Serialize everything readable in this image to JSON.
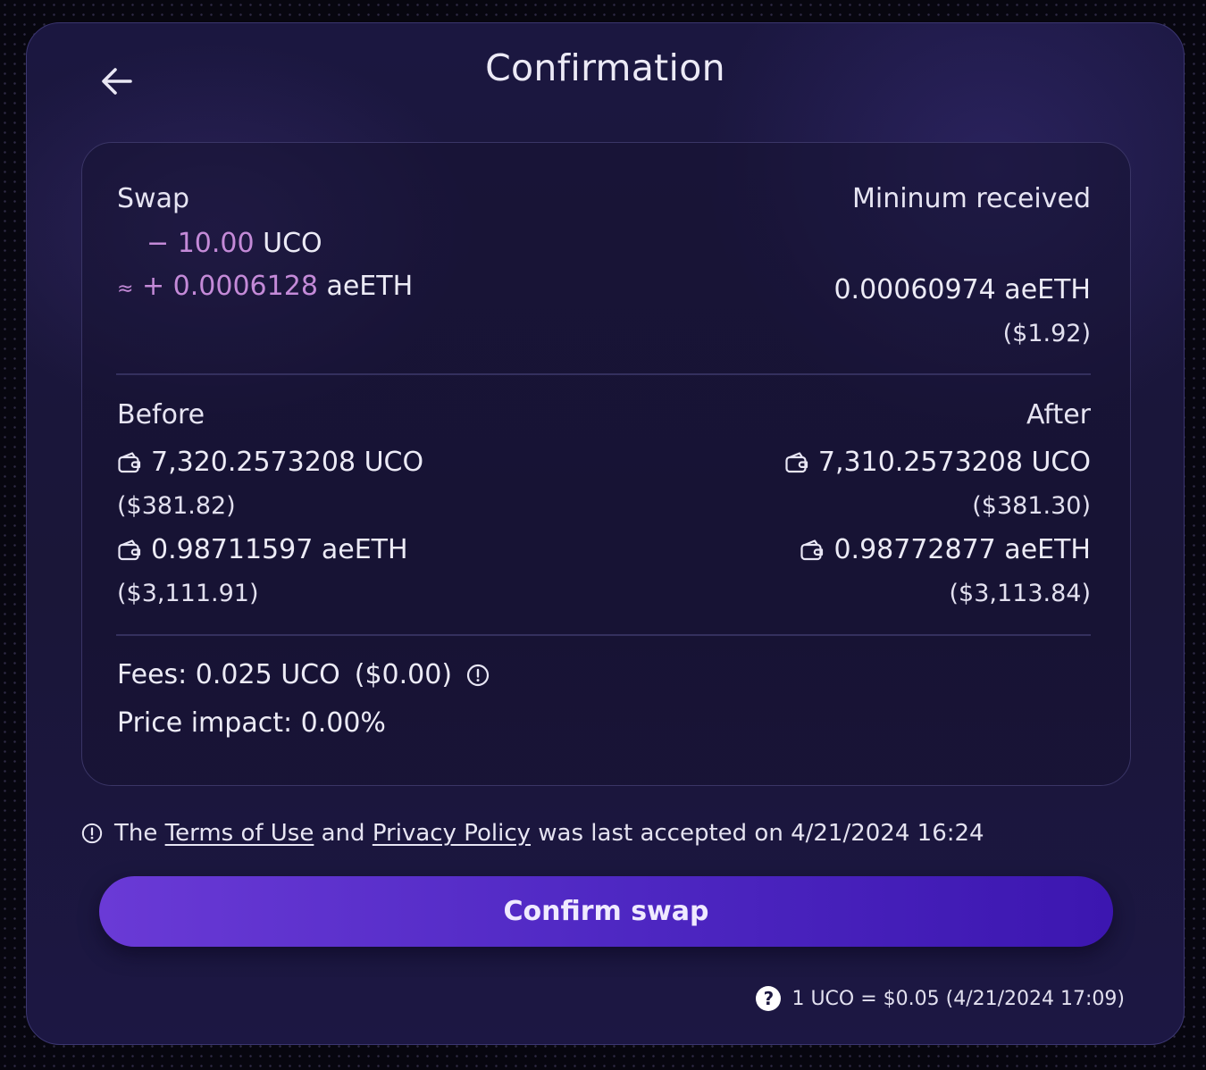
{
  "header": {
    "title": "Confirmation"
  },
  "swap": {
    "label": "Swap",
    "from_sign": "−",
    "from_amount": "10.00",
    "from_token": "UCO",
    "to_approx": "≈",
    "to_sign": "+",
    "to_amount": "0.0006128",
    "to_token": "aeETH"
  },
  "minimum_received": {
    "label": "Mininum received",
    "amount": "0.00060974 aeETH",
    "usd": "($1.92)"
  },
  "before": {
    "label": "Before",
    "uco_amount": "7,320.2573208 UCO",
    "uco_usd": "($381.82)",
    "aeeth_amount": "0.98711597 aeETH",
    "aeeth_usd": "($3,111.91)"
  },
  "after": {
    "label": "After",
    "uco_amount": "7,310.2573208 UCO",
    "uco_usd": "($381.30)",
    "aeeth_amount": "0.98772877 aeETH",
    "aeeth_usd": "($3,113.84)"
  },
  "fees": {
    "text": "Fees: 0.025 UCO",
    "usd": "($0.00)"
  },
  "price_impact": {
    "text": "Price impact: 0.00%"
  },
  "terms_notice": {
    "prefix": "The",
    "terms_link": "Terms of Use",
    "and": "and",
    "privacy_link": "Privacy Policy",
    "suffix": "was last accepted on 4/21/2024 16:24"
  },
  "confirm_button": {
    "label": "Confirm swap"
  },
  "rate": {
    "text": "1 UCO = $0.05 (4/21/2024 17:09)"
  },
  "colors": {
    "accent_pink": "#c48ad8",
    "button_start": "#6a3ad6",
    "button_end": "#3c16b0",
    "panel_bg": "#1b1740"
  },
  "icons": {
    "back": "arrow-left-icon",
    "wallet": "wallet-icon",
    "info": "info-circle-icon",
    "help": "question-circle-icon"
  }
}
